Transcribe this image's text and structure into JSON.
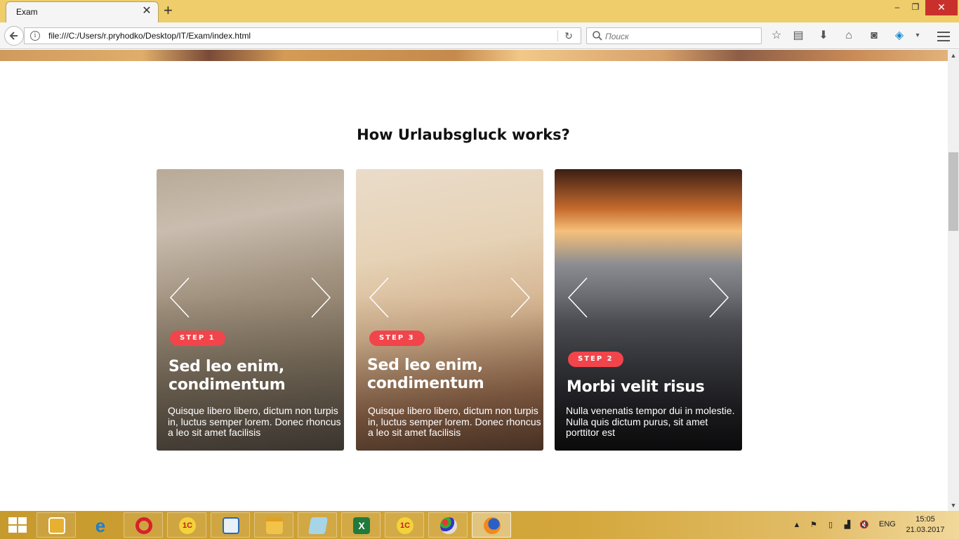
{
  "browser": {
    "tab_title": "Exam",
    "tab_close": "✕",
    "new_tab": "+",
    "url": "file:///C:/Users/r.pryhodko/Desktop/IT/Exam/index.html",
    "search_placeholder": "Поиск",
    "window_controls": {
      "minimize": "–",
      "maximize": "❐",
      "close": "✕"
    }
  },
  "page": {
    "title": "How Urlaubsgluck works?",
    "cards": [
      {
        "step": "STEP 1",
        "heading": "Sed leo enim, condimentum",
        "text": "Quisque libero libero, dictum non turpis in, luctus semper lorem. Donec rhoncus a leo sit amet facilisis"
      },
      {
        "step": "STEP 3",
        "heading": "Sed leo enim, condimentum",
        "text": "Quisque libero libero, dictum non turpis in, luctus semper lorem. Donec rhoncus a leo sit amet facilisis"
      },
      {
        "step": "STEP 2",
        "heading": "Morbi velit risus",
        "text": "Nulla venenatis tempor dui in molestie. Nulla quis dictum purus, sit amet porttitor est"
      }
    ]
  },
  "taskbar": {
    "apps": [
      "outlook-icon",
      "internet-explorer-icon",
      "opera-icon",
      "1c-icon",
      "network-app-icon",
      "file-explorer-icon",
      "notepad-icon",
      "excel-icon",
      "1c-icon",
      "paint-icon",
      "firefox-icon"
    ],
    "language": "ENG",
    "time": "15:05",
    "date": "21.03.2017"
  },
  "colors": {
    "accent": "#f2444b",
    "titlebar": "#eecd6a",
    "taskbar": "#d4a73c"
  }
}
